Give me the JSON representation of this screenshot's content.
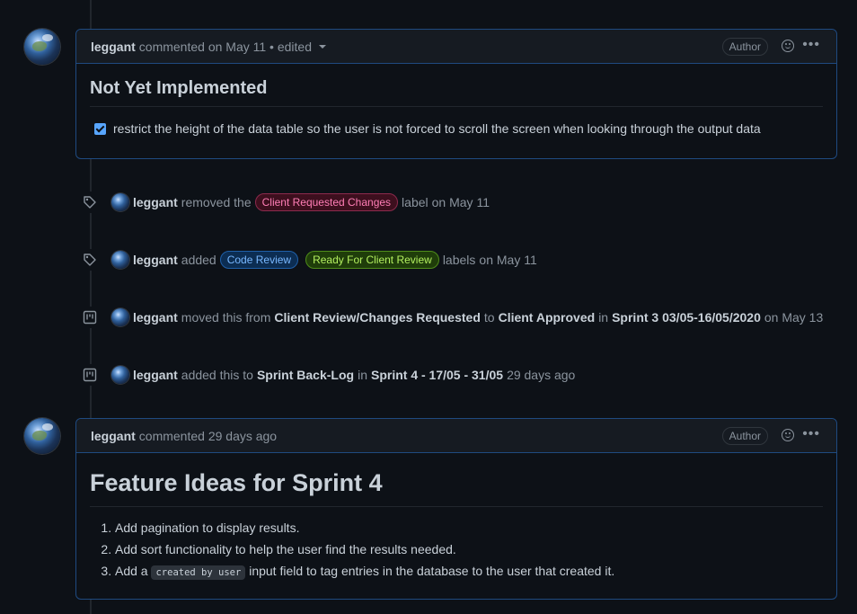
{
  "comments": [
    {
      "author": "leggant",
      "meta": "commented on May 11 • edited",
      "badge": "Author",
      "heading": "Not Yet Implemented",
      "task_text": "restrict the height of the data table so the user is not forced to scroll the screen when looking through the output data",
      "task_checked": true
    },
    {
      "author": "leggant",
      "meta": "commented 29 days ago",
      "badge": "Author",
      "heading": "Feature Ideas for Sprint 4",
      "list": [
        {
          "text": "Add pagination to display results."
        },
        {
          "text": "Add sort functionality to help the user find the results needed."
        },
        {
          "pre": "Add a",
          "code": "created by user",
          "post": "input field to tag entries in the database to the user that created it."
        }
      ]
    }
  ],
  "events": [
    {
      "icon": "tag-icon",
      "actor": "leggant",
      "parts": [
        "removed the",
        "label",
        "on May 11"
      ],
      "labels": [
        {
          "text": "Client Requested Changes",
          "color": "#ff7eb6"
        }
      ]
    },
    {
      "icon": "tag-icon",
      "actor": "leggant",
      "parts": [
        "added",
        "labels",
        "on May 11"
      ],
      "labels": [
        {
          "text": "Code Review",
          "color": "#79b8ff"
        },
        {
          "text": "Ready For Client Review",
          "color": "#b4f060"
        }
      ]
    },
    {
      "icon": "project-icon",
      "actor": "leggant",
      "parts": [
        "moved this from",
        "Client Review/Changes Requested",
        "to",
        "Client Approved",
        "in",
        "Sprint 3 03/05-16/05/2020",
        "on May 13"
      ]
    },
    {
      "icon": "project-icon",
      "actor": "leggant",
      "parts": [
        "added this to",
        "Sprint Back-Log",
        "in",
        "Sprint 4 - 17/05 - 31/05",
        "29 days ago"
      ]
    }
  ]
}
